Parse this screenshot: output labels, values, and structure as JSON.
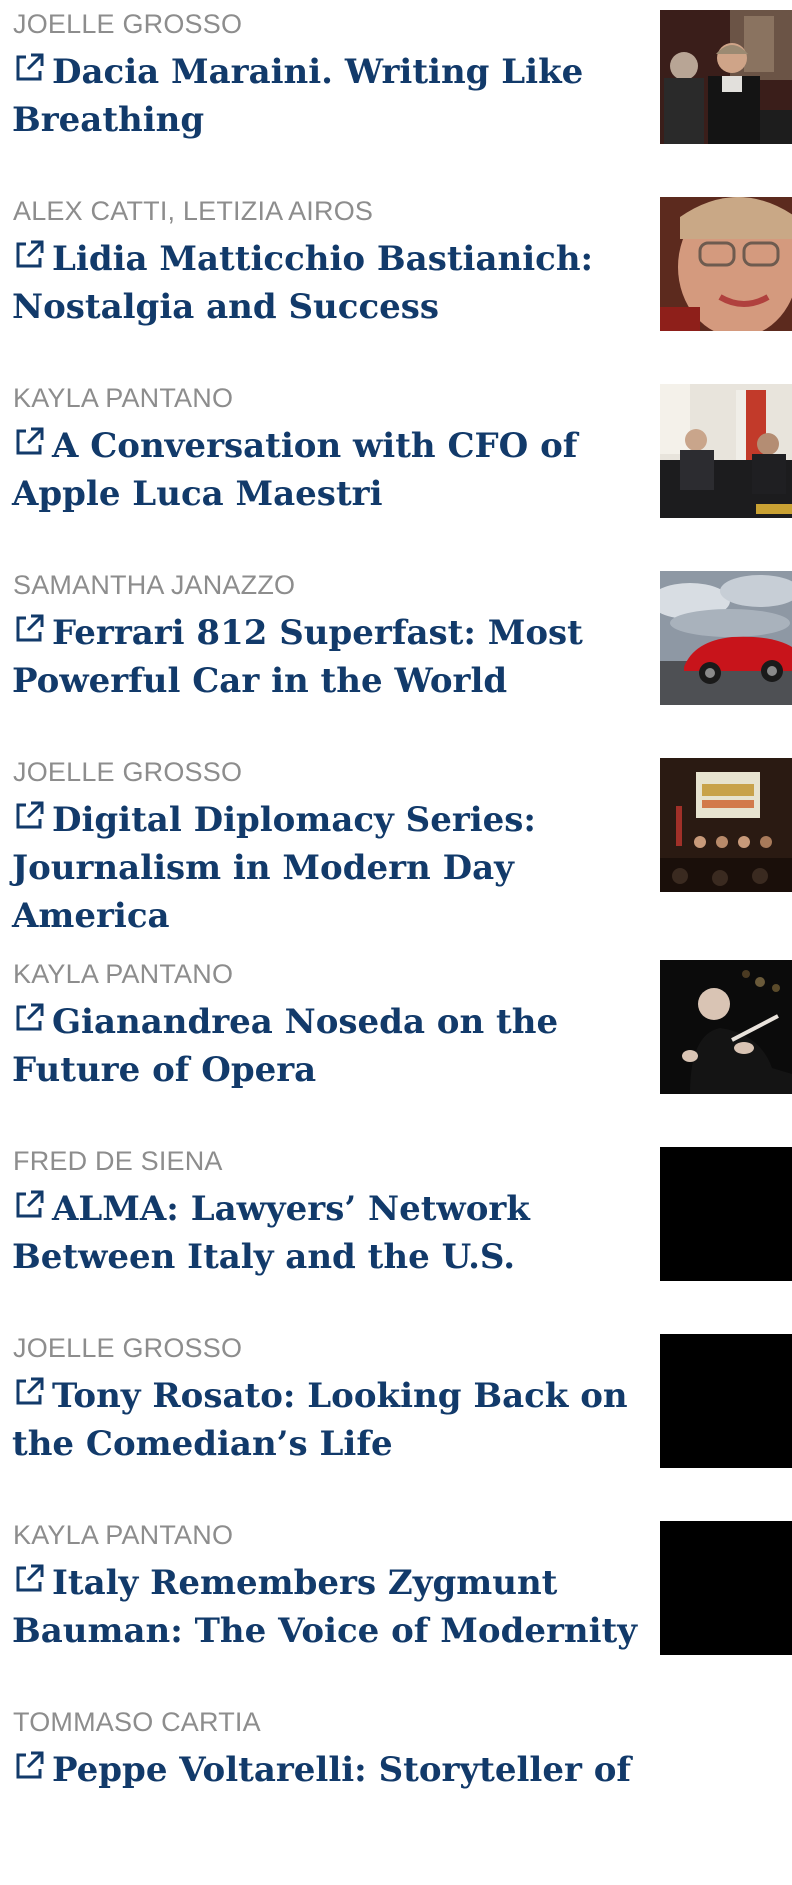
{
  "articles": [
    {
      "author": "JOELLE GROSSO",
      "title": "Dacia Maraini. Writing Like Breathing",
      "thumb_icon": "photo-two-women-at-event"
    },
    {
      "author": "ALEX CATTI, LETIZIA AIROS",
      "title": "Lidia Matticchio Bastianich: Nostalgia and Success",
      "thumb_icon": "photo-woman-portrait-glasses"
    },
    {
      "author": "KAYLA PANTANO",
      "title": "A Conversation with CFO of Apple Luca Maestri",
      "thumb_icon": "photo-panel-conversation"
    },
    {
      "author": "SAMANTHA JANAZZO",
      "title": "Ferrari 812 Superfast: Most Powerful Car in the World",
      "thumb_icon": "photo-red-ferrari"
    },
    {
      "author": "JOELLE GROSSO",
      "title": "Digital Diplomacy Series: Journalism in Modern Day America",
      "thumb_icon": "photo-conference-screen"
    },
    {
      "author": "KAYLA PANTANO",
      "title": "Gianandrea Noseda on the Future of Opera",
      "thumb_icon": "photo-conductor"
    },
    {
      "author": "FRED DE SIENA",
      "title": "ALMA: Lawyers’ Network Between Italy and the U.S.",
      "thumb_icon": "photo-black"
    },
    {
      "author": "JOELLE GROSSO",
      "title": "Tony Rosato: Looking Back on the Comedian’s Life",
      "thumb_icon": "photo-black"
    },
    {
      "author": "KAYLA PANTANO",
      "title": "Italy Remembers Zygmunt Bauman: The Voice of Modernity",
      "thumb_icon": "photo-black"
    },
    {
      "author": "TOMMASO CARTIA",
      "title": "Peppe Voltarelli: Storyteller of",
      "thumb_icon": "none"
    }
  ],
  "colors": {
    "title": "#123a6a",
    "author": "#8d8d8d",
    "background": "#ffffff"
  },
  "icons": {
    "title_prefix": "external-link-icon"
  }
}
